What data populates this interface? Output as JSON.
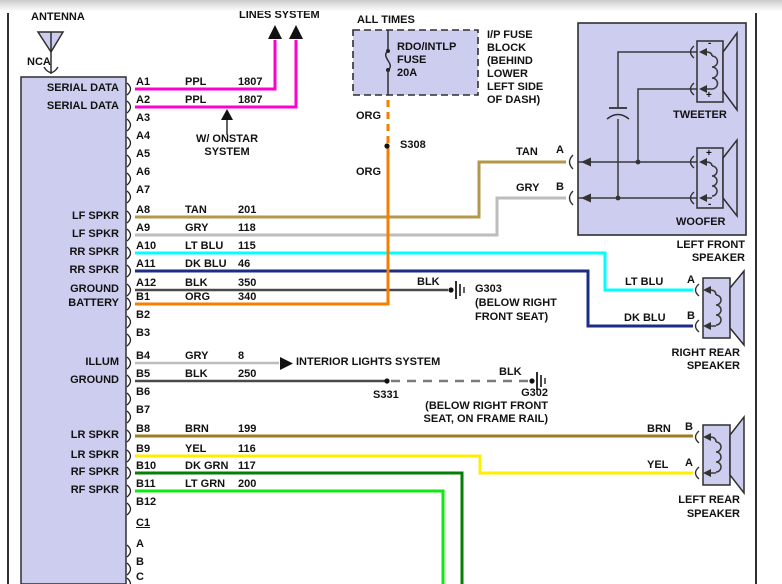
{
  "diagram": {
    "antenna": {
      "label": "ANTENNA",
      "connector": "NCA"
    },
    "top_arrow_target": "LINES SYSTEM",
    "onstar_note_lines": [
      "W/ ONSTAR",
      "SYSTEM"
    ],
    "power": {
      "all_times": "ALL TIMES",
      "fuse_lines": [
        "RDO/INTLP",
        "FUSE",
        "20A"
      ],
      "fuse_location_lines": [
        "I/P FUSE",
        "BLOCK",
        "(BEHIND",
        "LOWER",
        "LEFT SIDE",
        "OF DASH)"
      ],
      "wire_color_upper": "ORG",
      "splice": "S308",
      "wire_color_lower": "ORG"
    },
    "interior_lights": {
      "arrow_target": "INTERIOR LIGHTS SYSTEM"
    },
    "grounds": {
      "g303_wire": "BLK",
      "g303_lines": [
        "G303",
        "(BELOW RIGHT",
        "FRONT SEAT)"
      ],
      "s331": "S331",
      "g302_wire": "BLK",
      "g302_lines": [
        "G302",
        "(BELOW RIGHT FRONT",
        "SEAT, ON FRAME RAIL)"
      ]
    }
  },
  "connector": {
    "pins": [
      {
        "id": "A1",
        "label": "SERIAL DATA",
        "color": "PPL",
        "circuit": "1807"
      },
      {
        "id": "A2",
        "label": "SERIAL DATA",
        "color": "PPL",
        "circuit": "1807"
      },
      {
        "id": "A3"
      },
      {
        "id": "A4"
      },
      {
        "id": "A5"
      },
      {
        "id": "A6"
      },
      {
        "id": "A7"
      },
      {
        "id": "A8",
        "label": "LF SPKR",
        "color": "TAN",
        "circuit": "201"
      },
      {
        "id": "A9",
        "label": "LF SPKR",
        "color": "GRY",
        "circuit": "118"
      },
      {
        "id": "A10",
        "label": "RR SPKR",
        "color": "LT BLU",
        "circuit": "115"
      },
      {
        "id": "A11",
        "label": "RR SPKR",
        "color": "DK BLU",
        "circuit": "46"
      },
      {
        "id": "A12",
        "label": "GROUND",
        "color": "BLK",
        "circuit": "350"
      },
      {
        "id": "B1",
        "label": "BATTERY",
        "color": "ORG",
        "circuit": "340"
      },
      {
        "id": "B2"
      },
      {
        "id": "B3"
      },
      {
        "id": "B4",
        "label": "ILLUM",
        "color": "GRY",
        "circuit": "8"
      },
      {
        "id": "B5",
        "label": "GROUND",
        "color": "BLK",
        "circuit": "250"
      },
      {
        "id": "B6"
      },
      {
        "id": "B7"
      },
      {
        "id": "B8",
        "label": "LR SPKR",
        "color": "BRN",
        "circuit": "199"
      },
      {
        "id": "B9",
        "label": "LR SPKR",
        "color": "YEL",
        "circuit": "116"
      },
      {
        "id": "B10",
        "label": "RF SPKR",
        "color": "DK GRN",
        "circuit": "117"
      },
      {
        "id": "B11",
        "label": "RF SPKR",
        "color": "LT GRN",
        "circuit": "200"
      },
      {
        "id": "B12"
      },
      {
        "id": "C1",
        "section": true
      },
      {
        "id": "A"
      },
      {
        "id": "B"
      },
      {
        "id": "C"
      }
    ]
  },
  "speakers": {
    "left_front": {
      "name_lines": [
        "LEFT FRONT",
        "SPEAKER"
      ],
      "tweeter_label": "TWEETER",
      "woofer_label": "WOOFER",
      "terminal_a": {
        "wire": "TAN",
        "pin": "A"
      },
      "terminal_b": {
        "wire": "GRY",
        "pin": "B"
      },
      "tweeter_polarity": {
        "top": "-",
        "bottom": "+"
      },
      "woofer_polarity": {
        "top": "+",
        "bottom": "-"
      }
    },
    "right_rear": {
      "name_lines": [
        "RIGHT REAR",
        "SPEAKER"
      ],
      "terminal_a": {
        "wire": "LT BLU",
        "pin": "A"
      },
      "terminal_b": {
        "wire": "DK BLU",
        "pin": "B"
      }
    },
    "left_rear": {
      "name_lines": [
        "LEFT REAR",
        "SPEAKER"
      ],
      "terminal_b": {
        "wire": "BRN",
        "pin": "B"
      },
      "terminal_a": {
        "wire": "YEL",
        "pin": "A"
      }
    }
  },
  "colors": {
    "PPL": "#ff00cc",
    "TAN": "#b3974a",
    "GRY": "#bdbdbd",
    "LT_BLU": "#00ffff",
    "DK_BLU": "#1b2e83",
    "BLK": "#4a4a4a",
    "ORG": "#f57f00",
    "BRN": "#9c7c25",
    "YEL": "#ffee00",
    "DK_GRN": "#067d06",
    "LT_GRN": "#12e712",
    "BLK_DASH": "#7a7a7a",
    "block_fill": "#cdcdf0",
    "line": "#2f2f2f"
  }
}
